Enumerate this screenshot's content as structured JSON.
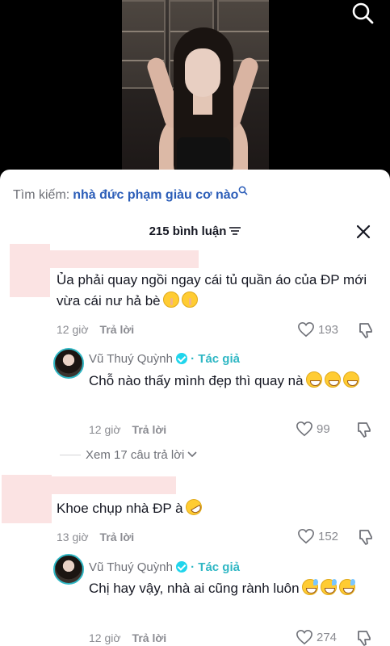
{
  "search": {
    "label": "Tìm kiếm:",
    "query": "nhà đức phạm giàu cơ nào"
  },
  "comments_header": {
    "count": "215 bình luận"
  },
  "comments": [
    {
      "text": "Ủa phải quay ngồi ngay cái tủ quần áo của ĐP mới vừa cái nư hả bè",
      "emojis": [
        "shushing-face",
        "shushing-face"
      ],
      "time": "12 giờ",
      "reply_label": "Trả lời",
      "likes": "193",
      "reply": {
        "author": "Vũ Thuý Quỳnh",
        "author_tag": "· Tác giả",
        "text": "Chỗ nào thấy mình đẹp thì quay nà",
        "emojis": [
          "grinning-face",
          "grinning-face",
          "grinning-face"
        ],
        "time": "12 giờ",
        "reply_label": "Trả lời",
        "likes": "99"
      },
      "view_more": "Xem 17 câu trả lời"
    },
    {
      "text": "Khoe chụp nhà ĐP à",
      "emojis": [
        "rolling-laughing-face"
      ],
      "time": "13 giờ",
      "reply_label": "Trả lời",
      "likes": "152",
      "reply": {
        "author": "Vũ Thuý Quỳnh",
        "author_tag": "· Tác giả",
        "text": "Chị hay vậy, nhà ai cũng rành luôn",
        "emojis": [
          "grinning-sweat-face",
          "grinning-sweat-face",
          "grinning-sweat-face"
        ],
        "time": "12 giờ",
        "reply_label": "Trả lời",
        "likes": "274"
      }
    }
  ],
  "colors": {
    "accent": "#2fb7c4",
    "search_query": "#2b5db8",
    "muted": "#8a8b91"
  }
}
